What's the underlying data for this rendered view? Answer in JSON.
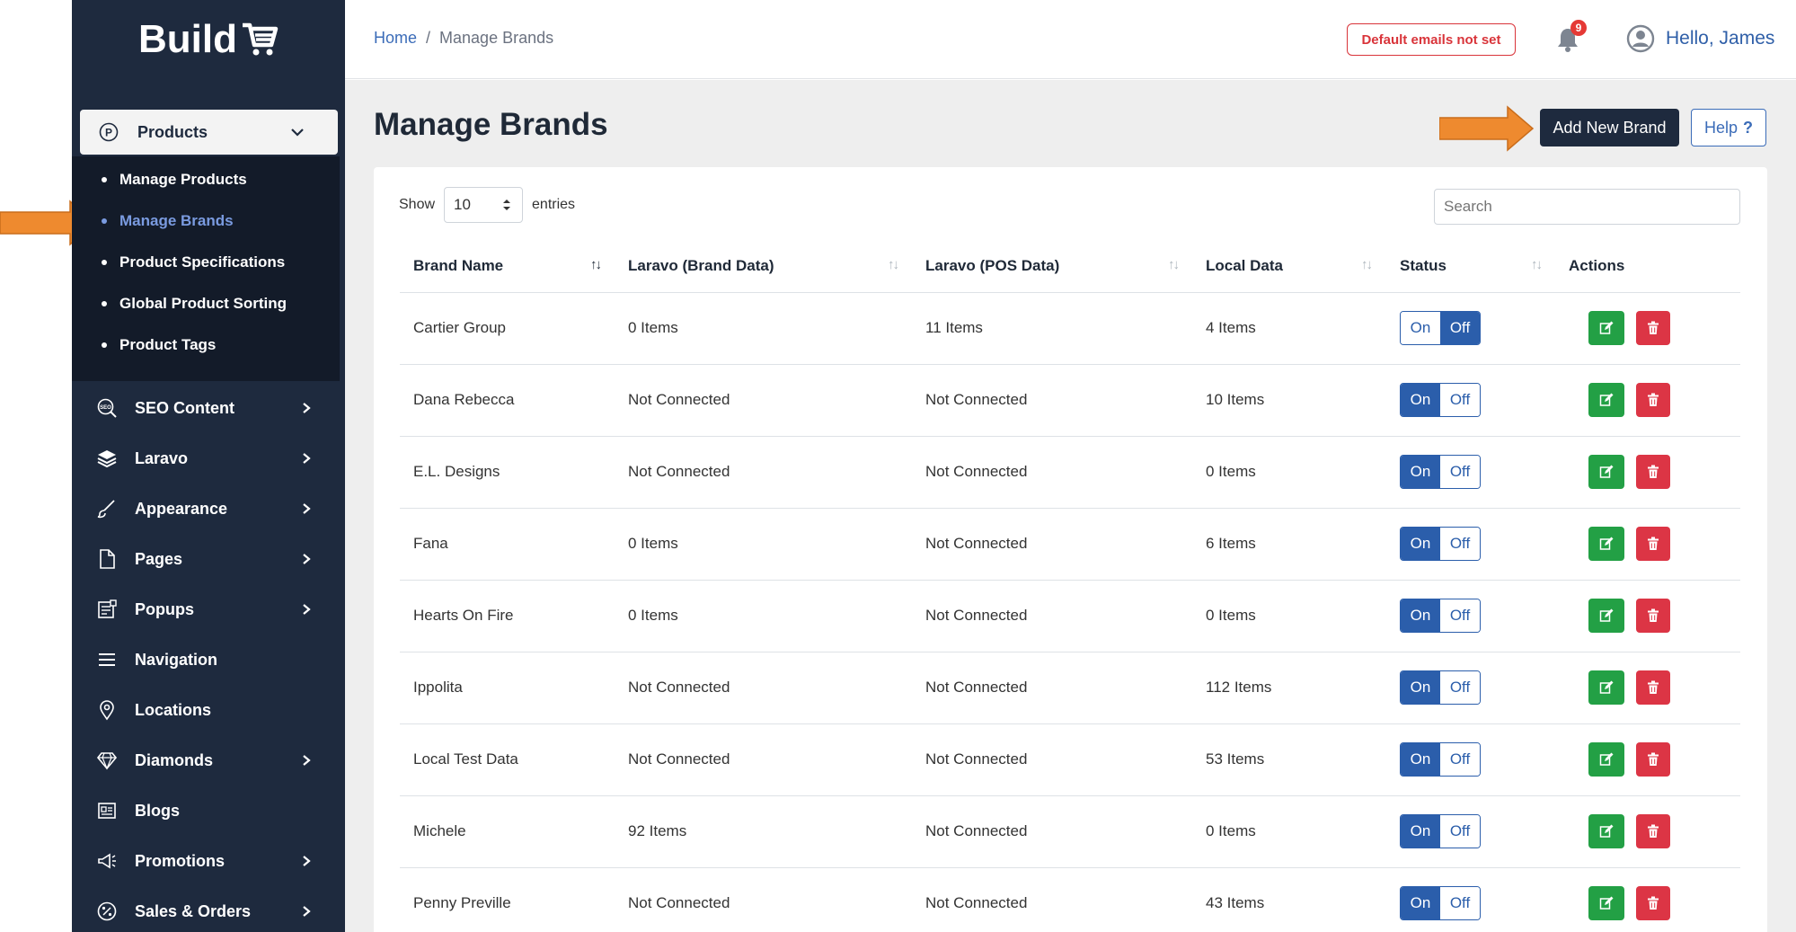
{
  "brand": {
    "logo_text": "Build"
  },
  "sidebar": {
    "products_label": "Products",
    "sub_items": [
      {
        "label": "Manage Products"
      },
      {
        "label": "Manage Brands"
      },
      {
        "label": "Product Specifications"
      },
      {
        "label": "Global Product Sorting"
      },
      {
        "label": "Product Tags"
      }
    ],
    "items": [
      {
        "label": "SEO Content"
      },
      {
        "label": "Laravo"
      },
      {
        "label": "Appearance"
      },
      {
        "label": "Pages"
      },
      {
        "label": "Popups"
      },
      {
        "label": "Navigation"
      },
      {
        "label": "Locations"
      },
      {
        "label": "Diamonds"
      },
      {
        "label": "Blogs"
      },
      {
        "label": "Promotions"
      },
      {
        "label": "Sales & Orders"
      }
    ]
  },
  "header": {
    "breadcrumb_home": "Home",
    "breadcrumb_sep": "/",
    "breadcrumb_current": "Manage Brands",
    "email_alert": "Default emails not set",
    "notification_count": "9",
    "greeting": "Hello, James"
  },
  "main": {
    "title": "Manage Brands",
    "add_button": "Add New Brand",
    "help_button": "Help",
    "help_mark": "?",
    "show_label": "Show",
    "entries_value": "10",
    "entries_label": "entries",
    "search_placeholder": "Search"
  },
  "table": {
    "headers": [
      "Brand Name",
      "Laravo (Brand Data)",
      "Laravo (POS Data)",
      "Local Data",
      "Status",
      "Actions"
    ],
    "on_label": "On",
    "off_label": "Off",
    "rows": [
      {
        "brand": "Cartier Group",
        "brand_data": "0 Items",
        "pos_data": "11 Items",
        "local": "4 Items",
        "status": "off"
      },
      {
        "brand": "Dana Rebecca",
        "brand_data": "Not Connected",
        "pos_data": "Not Connected",
        "local": "10 Items",
        "status": "on"
      },
      {
        "brand": "E.L. Designs",
        "brand_data": "Not Connected",
        "pos_data": "Not Connected",
        "local": "0 Items",
        "status": "on"
      },
      {
        "brand": "Fana",
        "brand_data": "0 Items",
        "pos_data": "Not Connected",
        "local": "6 Items",
        "status": "on"
      },
      {
        "brand": "Hearts On Fire",
        "brand_data": "0 Items",
        "pos_data": "Not Connected",
        "local": "0 Items",
        "status": "on"
      },
      {
        "brand": "Ippolita",
        "brand_data": "Not Connected",
        "pos_data": "Not Connected",
        "local": "112 Items",
        "status": "on"
      },
      {
        "brand": "Local Test Data",
        "brand_data": "Not Connected",
        "pos_data": "Not Connected",
        "local": "53 Items",
        "status": "on"
      },
      {
        "brand": "Michele",
        "brand_data": "92 Items",
        "pos_data": "Not Connected",
        "local": "0 Items",
        "status": "on"
      },
      {
        "brand": "Penny Preville",
        "brand_data": "Not Connected",
        "pos_data": "Not Connected",
        "local": "43 Items",
        "status": "on"
      }
    ]
  },
  "colors": {
    "sidebar": "#1e2a3e",
    "accent": "#2b5eab",
    "edit": "#23a045",
    "delete": "#dc3545",
    "annotation": "#ee8a2f"
  }
}
